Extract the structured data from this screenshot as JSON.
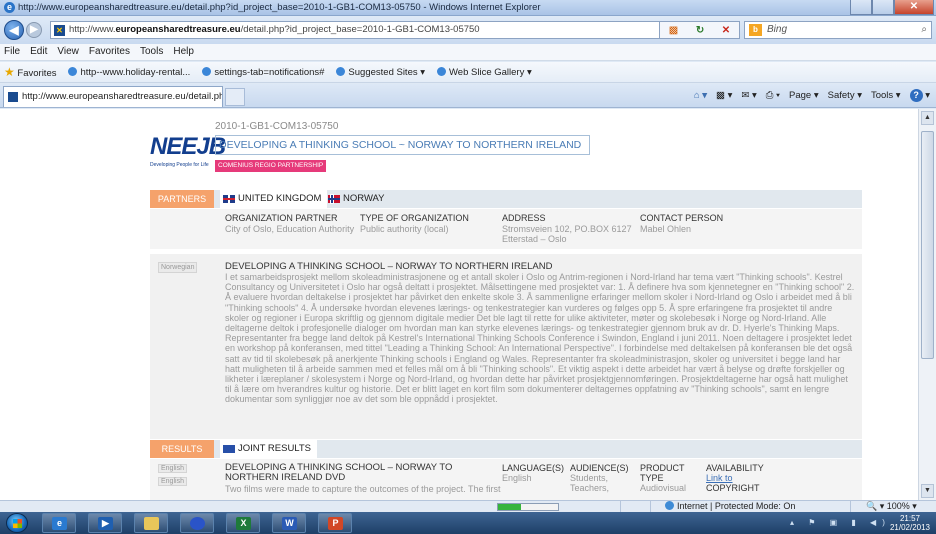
{
  "window": {
    "title": "http://www.europeansharedtreasure.eu/detail.php?id_project_base=2010-1-GB1-COM13-05750 - Windows Internet Explorer"
  },
  "address": {
    "url_prefix": "http://www.",
    "url_domain": "europeansharedtreasure.eu",
    "url_path": "/detail.php?id_project_base=2010-1-GB1-COM13-05750",
    "search_placeholder": "Bing"
  },
  "menu": [
    "File",
    "Edit",
    "View",
    "Favorites",
    "Tools",
    "Help"
  ],
  "favorites": {
    "label": "Favorites",
    "items": [
      "http--www.holiday-rental...",
      "settings-tab=notifications#",
      "Suggested Sites ▾",
      "Web Slice Gallery ▾"
    ]
  },
  "tab": {
    "label": "http://www.europeansharedtreasure.eu/detail.ph..."
  },
  "commands": {
    "page": "Page ▾",
    "safety": "Safety ▾",
    "tools": "Tools ▾"
  },
  "page": {
    "logo": "NEEJB",
    "logo_sub": "Developing People for Life",
    "project_id": "2010-1-GB1-COM13-05750",
    "project_title": "DEVELOPING A THINKING SCHOOL ~ NORWAY TO NORTHERN IRELAND",
    "badge": "COMENIUS REGIO PARTNERSHIP",
    "partners": {
      "label": "PARTNERS",
      "tabs": [
        "UNITED KINGDOM",
        "NORWAY"
      ],
      "headers": {
        "org": "ORGANIZATION PARTNER",
        "type": "TYPE OF ORGANIZATION",
        "address": "ADDRESS",
        "contact": "CONTACT PERSON"
      },
      "org": "City of Oslo, Education Authority",
      "type": "Public authority (local)",
      "address_line1": "Stromsveien 102, PO.BOX 6127",
      "address_line2": "Etterstad – Oslo",
      "contact": "Mabel Ohlen"
    },
    "description": {
      "language": "Norwegian",
      "title": "DEVELOPING A THINKING SCHOOL – NORWAY TO NORTHERN IRELAND",
      "text": "I et samarbeidsprosjekt mellom skoleadministrasjonene og et antall skoler i Oslo og Antrim-regionen i Nord-Irland har tema vært \"Thinking schools\". Kestrel Consultancy og Universitetet i Oslo har også deltatt i prosjektet. Målsettingene med prosjektet var: 1. Å definere hva som kjennetegner en \"Thinking school\" 2. Å evaluere hvordan deltakelse i prosjektet har påvirket den enkelte skole 3. Å sammenligne erfaringer mellom skoler i Nord-Irland og Oslo i arbeidet med å bli \"Thinking schools\" 4. Å undersøke hvordan elevenes lærings- og tenkestrategier kan vurderes og følges opp 5. Å spre erfaringene fra prosjektet til andre skoler og regioner i Europa skriftlig og gjennom digitale medier Det ble lagt til rette for ulike aktiviteter, møter og skolebesøk i Norge og Nord-Irland. Alle deltagerne deltok i profesjonelle dialoger om hvordan man kan styrke elevenes lærings- og tenkestrategier gjennom bruk av dr. D. Hyerle's Thinking Maps. Representanter fra begge land deltok på Kestrel's International Thinking Schools Conference i Swindon, England i juni 2011. Noen deltagere i prosjektet ledet en workshop på konferansen, med tittel \"Leading a Thinking School: An International Perspective\". I forbindelse med deltakelsen på konferansen ble det også satt av tid til skolebesøk på anerkjente Thinking schools i England og Wales. Representanter fra skoleadministrasjon, skoler og universitet i begge land har hatt muligheten til å arbeide sammen med et felles mål om å bli \"Thinking schools\". Et viktig aspekt i dette arbeidet har vært å belyse og drøfte forskjeller og likheter i læreplaner / skolesystem i Norge og Nord-Irland, og hvordan dette har påvirket prosjektgjennomføringen. Prosjektdeltagerne har også hatt mulighet til å lære om hverandres kultur og historie. Det er blitt laget en kort film som dokumenterer deltagernes oppfatning av \"Thinking schools\", samt en lengre dokumentar som synliggjør noe av det som ble oppnådd i prosjektet."
    },
    "results": {
      "label": "RESULTS",
      "tab": "JOINT RESULTS",
      "lang_badges": [
        "English",
        "English"
      ],
      "title": "DEVELOPING A THINKING SCHOOL – NORWAY TO NORTHERN IRELAND DVD",
      "desc": "Two films were made to capture the outcomes of the project. The first",
      "headers": {
        "language": "LANGUAGE(S)",
        "audience": "AUDIENCE(S)",
        "product": "PRODUCT",
        "product2": "TYPE",
        "availability": "AVAILABILITY"
      },
      "language": "English",
      "audience1": "Students,",
      "audience2": "Teachers,",
      "product_type": "Audiovisual",
      "link": "Link to",
      "copyright": "COPYRIGHT"
    }
  },
  "status": {
    "progress": 0.38,
    "zone": "Internet | Protected Mode: On",
    "zoom": "100%"
  },
  "taskbar": {
    "time": "21:57",
    "date": "21/02/2013"
  }
}
